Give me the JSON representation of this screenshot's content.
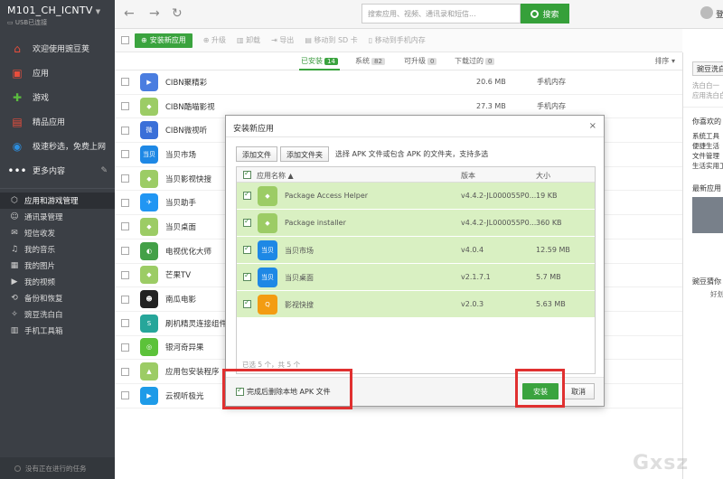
{
  "device": {
    "name": "M101_CH_ICNTV",
    "connection": "USB已连接"
  },
  "sidebar": {
    "top_items": [
      {
        "label": "欢迎使用豌豆荚",
        "icon": "home-icon",
        "color": "#e94e3c"
      },
      {
        "label": "应用",
        "icon": "bag-icon",
        "color": "#e94e3c"
      },
      {
        "label": "游戏",
        "icon": "gamepad-icon",
        "color": "#5bbd3f"
      },
      {
        "label": "精品应用",
        "icon": "briefcase-icon",
        "color": "#e94e3c"
      },
      {
        "label": "极速秒选，免费上网",
        "icon": "wifi-icon",
        "color": "#2c8fe0"
      },
      {
        "label": "更多内容",
        "icon": "more-icon",
        "color": "#ffffff"
      }
    ],
    "sub_items": [
      {
        "label": "应用和游戏管理",
        "icon": "cube-icon",
        "active": true
      },
      {
        "label": "通讯录管理",
        "icon": "contacts-icon"
      },
      {
        "label": "短信收发",
        "icon": "sms-icon"
      },
      {
        "label": "我的音乐",
        "icon": "music-icon"
      },
      {
        "label": "我的图片",
        "icon": "picture-icon"
      },
      {
        "label": "我的视频",
        "icon": "video-icon"
      },
      {
        "label": "备份和恢复",
        "icon": "backup-icon"
      },
      {
        "label": "豌豆洗白白",
        "icon": "clean-icon"
      },
      {
        "label": "手机工具箱",
        "icon": "toolbox-icon"
      }
    ],
    "footer": "没有正在进行的任务"
  },
  "topbar": {
    "search_placeholder": "搜索应用、视频、通讯录和短信...",
    "search_button": "搜索",
    "user_label": "登"
  },
  "toolbar": {
    "install_label": "安装新应用",
    "upgrade": "升级",
    "uninstall": "卸载",
    "export": "导出",
    "move_to_sd": "移动到 SD 卡",
    "move_to_phone": "移动到手机内存"
  },
  "tabs": [
    {
      "label": "已安装",
      "count": "14",
      "active": true
    },
    {
      "label": "系统",
      "count": "82"
    },
    {
      "label": "可升级",
      "count": "0"
    },
    {
      "label": "下载过的",
      "count": "0"
    }
  ],
  "sort_label": "排序",
  "apps": [
    {
      "name": "CIBN聚精彩",
      "size": "20.6 MB",
      "location": "手机内存",
      "color": "#4a7de0",
      "glyph": "▶"
    },
    {
      "name": "CIBN酷喵影视",
      "size": "27.3 MB",
      "location": "手机内存",
      "color": "#9ccc65",
      "glyph": "◆"
    },
    {
      "name": "CIBN微视听",
      "size": "",
      "location": "",
      "color": "#3a6fd8",
      "glyph": "微"
    },
    {
      "name": "当贝市场",
      "size": "",
      "location": "",
      "color": "#1e88e5",
      "glyph": "当贝"
    },
    {
      "name": "当贝影视快搜",
      "size": "",
      "location": "",
      "color": "#9ccc65",
      "glyph": "◆"
    },
    {
      "name": "当贝助手",
      "size": "",
      "location": "",
      "color": "#2196f3",
      "glyph": "✈"
    },
    {
      "name": "当贝桌面",
      "size": "",
      "location": "",
      "color": "#9ccc65",
      "glyph": "◆"
    },
    {
      "name": "电视优化大师",
      "size": "",
      "location": "",
      "color": "#43a047",
      "glyph": "◐"
    },
    {
      "name": "芒果TV",
      "size": "",
      "location": "",
      "color": "#9ccc65",
      "glyph": "◆"
    },
    {
      "name": "南瓜电影",
      "size": "",
      "location": "",
      "color": "#222222",
      "glyph": "☻"
    },
    {
      "name": "刷机精灵连接组件",
      "size": "",
      "location": "",
      "color": "#26a69a",
      "glyph": "S"
    },
    {
      "name": "银河奇异果",
      "size": "",
      "location": "",
      "color": "#5cc23a",
      "glyph": "◎"
    },
    {
      "name": "应用包安装程序",
      "size": "360 KB",
      "location": "手机内存",
      "color": "#9ccc65",
      "glyph": "▲"
    },
    {
      "name": "云视听极光",
      "size": "23.6 MB",
      "location": "手机内存",
      "color": "#1e9be8",
      "glyph": "▶"
    }
  ],
  "right_panel": {
    "button": "豌豆洗白",
    "desc1": "洗白白一",
    "desc2": "应用洗白白",
    "fav_title": "你喜欢的",
    "fav_links": [
      "系统工具",
      "便捷生活",
      "文件管理",
      "生活实用工"
    ],
    "new_title": "最新应用",
    "bottom_title": "豌豆猜你",
    "bottom_sub": "好划"
  },
  "dialog": {
    "title": "安装新应用",
    "add_file": "添加文件",
    "add_folder": "添加文件夹",
    "hint": "选择 APK 文件或包含 APK 的文件夹，支持多选",
    "col_name": "应用名称",
    "col_version": "版本",
    "col_size": "大小",
    "files": [
      {
        "name": "Package Access Helper",
        "version": "v4.4.2-JL000055P0...",
        "size": "19 KB",
        "color": "#9ccc65",
        "glyph": "◆"
      },
      {
        "name": "Package installer",
        "version": "v4.4.2-JL000055P0...",
        "size": "360 KB",
        "color": "#9ccc65",
        "glyph": "◆"
      },
      {
        "name": "当贝市场",
        "version": "v4.0.4",
        "size": "12.59 MB",
        "color": "#1e88e5",
        "glyph": "当贝"
      },
      {
        "name": "当贝桌面",
        "version": "v2.1.7.1",
        "size": "5.7 MB",
        "color": "#1e88e5",
        "glyph": "当贝"
      },
      {
        "name": "影视快搜",
        "version": "v2.0.3",
        "size": "5.63 MB",
        "color": "#f39c12",
        "glyph": "Q"
      }
    ],
    "status": "已选 5 个，共 5 个",
    "delete_option": "完成后删除本地 APK 文件",
    "ok": "安装",
    "cancel": "取消"
  },
  "watermark": "Gxsz"
}
